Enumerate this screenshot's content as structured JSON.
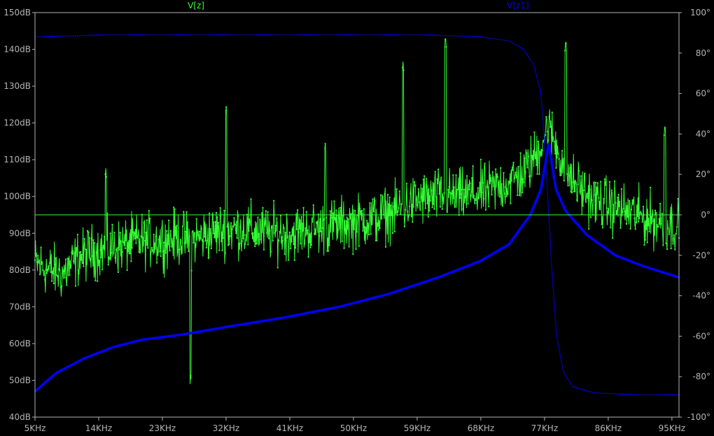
{
  "chart_data": {
    "type": "line",
    "background": "#000000",
    "plot_border_color": "#b4b4b4",
    "grid": false,
    "x_axis": {
      "range_hz": [
        5000,
        96000
      ],
      "ticks": [
        {
          "value": 5000,
          "label": "5KHz"
        },
        {
          "value": 14000,
          "label": "14KHz"
        },
        {
          "value": 23000,
          "label": "23KHz"
        },
        {
          "value": 32000,
          "label": "32KHz"
        },
        {
          "value": 41000,
          "label": "41KHz"
        },
        {
          "value": 50000,
          "label": "50KHz"
        },
        {
          "value": 59000,
          "label": "59KHz"
        },
        {
          "value": 68000,
          "label": "68KHz"
        },
        {
          "value": 77000,
          "label": "77KHz"
        },
        {
          "value": 86000,
          "label": "86KHz"
        },
        {
          "value": 95000,
          "label": "95KHz"
        }
      ]
    },
    "y_left": {
      "range": [
        40,
        150
      ],
      "unit": "dB",
      "ticks": [
        {
          "value": 40,
          "label": "40dB"
        },
        {
          "value": 50,
          "label": "50dB"
        },
        {
          "value": 60,
          "label": "60dB"
        },
        {
          "value": 70,
          "label": "70dB"
        },
        {
          "value": 80,
          "label": "80dB"
        },
        {
          "value": 90,
          "label": "90dB"
        },
        {
          "value": 100,
          "label": "100dB"
        },
        {
          "value": 110,
          "label": "110dB"
        },
        {
          "value": 120,
          "label": "120dB"
        },
        {
          "value": 130,
          "label": "130dB"
        },
        {
          "value": 140,
          "label": "140dB"
        },
        {
          "value": 150,
          "label": "150dB"
        }
      ]
    },
    "y_right": {
      "range": [
        -100,
        100
      ],
      "unit": "degrees",
      "ticks": [
        {
          "value": -100,
          "label": "-100°"
        },
        {
          "value": -80,
          "label": "-80°"
        },
        {
          "value": -60,
          "label": "-60°"
        },
        {
          "value": -40,
          "label": "-40°"
        },
        {
          "value": -20,
          "label": "-20°"
        },
        {
          "value": 0,
          "label": "0°"
        },
        {
          "value": 20,
          "label": "20°"
        },
        {
          "value": 40,
          "label": "40°"
        },
        {
          "value": 60,
          "label": "60°"
        },
        {
          "value": 80,
          "label": "80°"
        },
        {
          "value": 100,
          "label": "100°"
        }
      ]
    },
    "series": [
      {
        "name": "V[z]",
        "color": "#33ff33",
        "style": "noisy line with markers",
        "magnitude_points_db": [
          [
            5000,
            82
          ],
          [
            7000,
            80
          ],
          [
            9000,
            79
          ],
          [
            11000,
            83
          ],
          [
            13000,
            85
          ],
          [
            16000,
            86
          ],
          [
            18000,
            87
          ],
          [
            20000,
            88
          ],
          [
            23000,
            88
          ],
          [
            25000,
            89
          ],
          [
            27000,
            88
          ],
          [
            30000,
            90
          ],
          [
            32000,
            91
          ],
          [
            35000,
            91
          ],
          [
            38000,
            90
          ],
          [
            41000,
            90
          ],
          [
            44000,
            91
          ],
          [
            47000,
            92
          ],
          [
            50000,
            93
          ],
          [
            53000,
            94
          ],
          [
            56000,
            96
          ],
          [
            59000,
            99
          ],
          [
            62000,
            100
          ],
          [
            65000,
            100
          ],
          [
            68000,
            101
          ],
          [
            71000,
            103
          ],
          [
            74000,
            106
          ],
          [
            76000,
            112
          ],
          [
            77500,
            119
          ],
          [
            79000,
            112
          ],
          [
            81000,
            104
          ],
          [
            84000,
            99
          ],
          [
            87000,
            97
          ],
          [
            90000,
            95
          ],
          [
            93000,
            93
          ],
          [
            96000,
            92
          ]
        ],
        "spikes": [
          [
            15000,
            108
          ],
          [
            32000,
            125
          ],
          [
            46000,
            115
          ],
          [
            57000,
            137
          ],
          [
            63000,
            144
          ],
          [
            80000,
            143
          ],
          [
            94000,
            120
          ],
          [
            27000,
            52
          ]
        ],
        "noise_amplitude_db": 6
      },
      {
        "name": "V[z1]",
        "color": "#0000ff",
        "style": "magnitude solid, phase thin dotted",
        "resonance_hz": 77600,
        "magnitude_points_db": [
          [
            5000,
            47
          ],
          [
            8000,
            52
          ],
          [
            12000,
            56
          ],
          [
            16000,
            59
          ],
          [
            20000,
            61
          ],
          [
            26000,
            62.5
          ],
          [
            32000,
            64.5
          ],
          [
            40000,
            67
          ],
          [
            48000,
            70
          ],
          [
            55000,
            73.5
          ],
          [
            62000,
            78
          ],
          [
            68000,
            82.5
          ],
          [
            72000,
            87
          ],
          [
            75000,
            95
          ],
          [
            76500,
            102
          ],
          [
            77600,
            114.5
          ],
          [
            78600,
            102
          ],
          [
            80000,
            96
          ],
          [
            83000,
            89.5
          ],
          [
            87000,
            84
          ],
          [
            91000,
            81
          ],
          [
            96000,
            78
          ]
        ],
        "phase_points_deg": [
          [
            5000,
            88
          ],
          [
            15000,
            89
          ],
          [
            30000,
            89
          ],
          [
            45000,
            89
          ],
          [
            60000,
            89
          ],
          [
            68000,
            88
          ],
          [
            72000,
            86
          ],
          [
            74000,
            82
          ],
          [
            75500,
            74
          ],
          [
            76500,
            60
          ],
          [
            77200,
            25
          ],
          [
            77600,
            0
          ],
          [
            78000,
            -25
          ],
          [
            78700,
            -60
          ],
          [
            79700,
            -78
          ],
          [
            81000,
            -85
          ],
          [
            84000,
            -88
          ],
          [
            90000,
            -89
          ],
          [
            96000,
            -89
          ]
        ]
      }
    ]
  }
}
